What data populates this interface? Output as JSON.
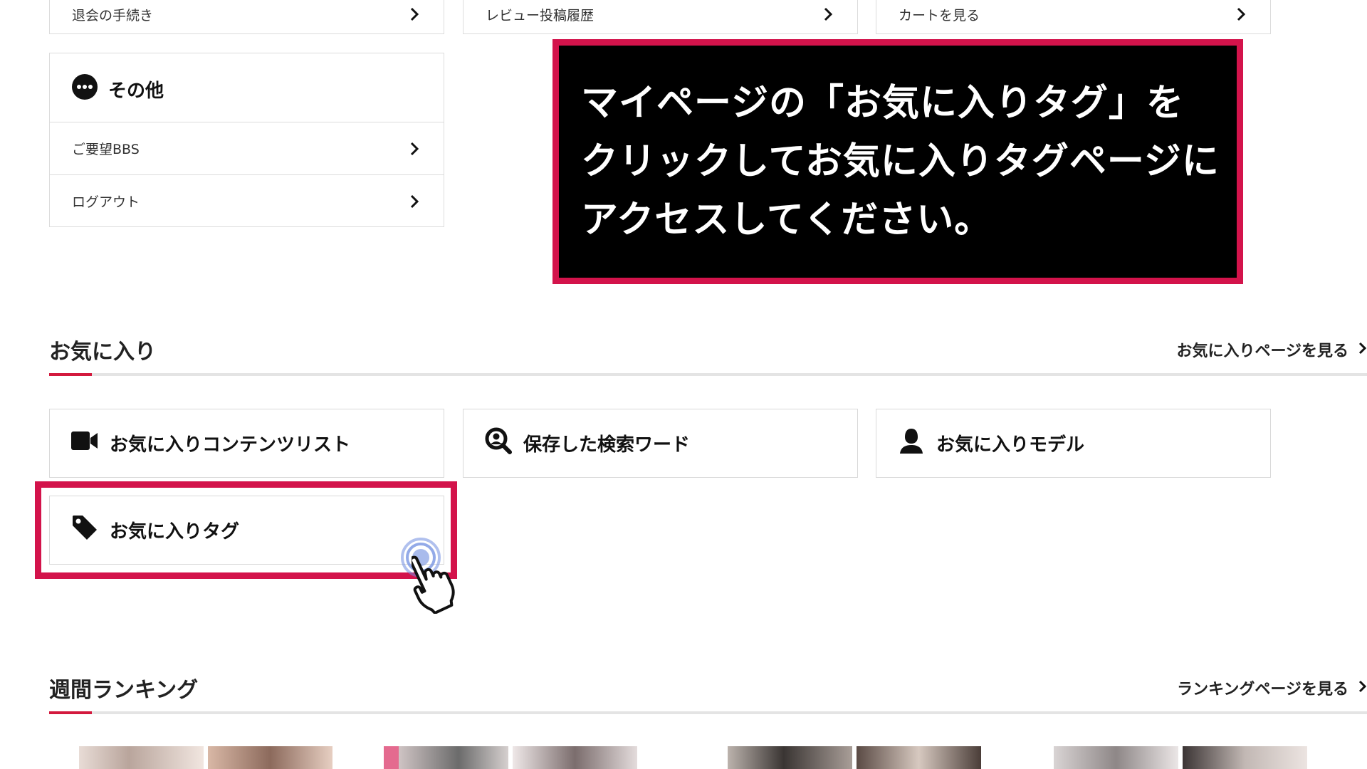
{
  "top_row": [
    {
      "label": "退会の手続き"
    },
    {
      "label": "レビュー投稿履歴"
    },
    {
      "label": "カートを見る"
    }
  ],
  "other_group": {
    "title": "その他",
    "icon": "more-dots-icon",
    "items": [
      {
        "label": "ご要望BBS"
      },
      {
        "label": "ログアウト"
      }
    ]
  },
  "callout": {
    "lines": [
      "マイページの「お気に入りタグ」を",
      "クリックしてお気に入りタグページに",
      "アクセスしてください。"
    ],
    "border_color": "#d3134b"
  },
  "favorites": {
    "title": "お気に入り",
    "link": "お気に入りページを見る",
    "buttons": [
      {
        "label": "お気に入りコンテンツリスト",
        "icon": "video-camera-icon"
      },
      {
        "label": "保存した検索ワード",
        "icon": "user-search-icon"
      },
      {
        "label": "お気に入りモデル",
        "icon": "person-icon"
      },
      {
        "label": "お気に入りタグ",
        "icon": "tag-icon"
      }
    ]
  },
  "ranking": {
    "title": "週間ランキング",
    "link": "ランキングページを見る"
  },
  "colors": {
    "accent": "#d3193d",
    "highlight": "#d3134b",
    "click_ring": "#6f8de0"
  }
}
